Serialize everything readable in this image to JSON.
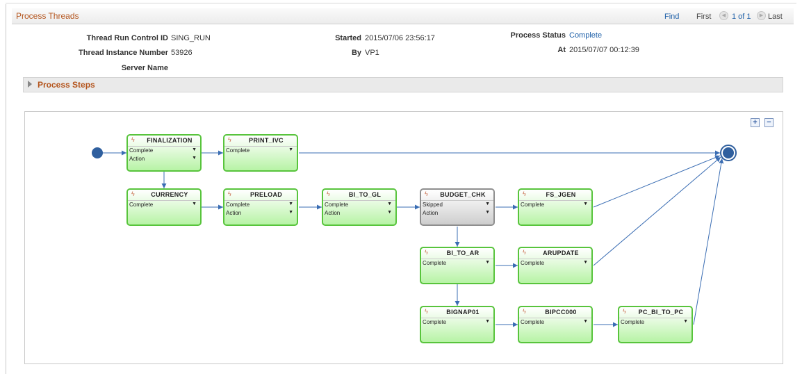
{
  "header": {
    "title": "Process Threads",
    "find": "Find",
    "first": "First",
    "count": "1 of 1",
    "last": "Last"
  },
  "fields": {
    "run_control_label": "Thread Run Control ID",
    "run_control_value": "SING_RUN",
    "instance_label": "Thread Instance Number",
    "instance_value": "53926",
    "server_label": "Server Name",
    "server_value": "",
    "started_label": "Started",
    "started_value": "2015/07/06 23:56:17",
    "by_label": "By",
    "by_value": "VP1",
    "status_label": "Process Status",
    "status_value": "Complete",
    "at_label": "At",
    "at_value": "2015/07/07 00:12:39"
  },
  "steps_section": {
    "title": "Process Steps"
  },
  "zoom": {
    "in": "+",
    "out": "−"
  },
  "icons": {
    "step": "lightning-icon",
    "expand": "triangle-right-icon",
    "dropdown": "caret-down-icon",
    "nav": "circle-arrow-icon"
  },
  "colors": {
    "title": "#b4541c",
    "link": "#1d5fa8",
    "node_border": "#58c43c",
    "node_skipped_border": "#8e8e8e",
    "connector": "#3a6db3"
  },
  "nodes": [
    {
      "id": "FINALIZATION",
      "status": "Complete",
      "action": "Action",
      "skipped": false
    },
    {
      "id": "PRINT_IVC",
      "status": "Complete",
      "action": "",
      "skipped": false
    },
    {
      "id": "CURRENCY",
      "status": "Complete",
      "action": "",
      "skipped": false
    },
    {
      "id": "PRELOAD",
      "status": "Complete",
      "action": "Action",
      "skipped": false
    },
    {
      "id": "BI_TO_GL",
      "status": "Complete",
      "action": "Action",
      "skipped": false
    },
    {
      "id": "BUDGET_CHK",
      "status": "Skipped",
      "action": "Action",
      "skipped": true
    },
    {
      "id": "FS_JGEN",
      "status": "Complete",
      "action": "",
      "skipped": false
    },
    {
      "id": "BI_TO_AR",
      "status": "Complete",
      "action": "",
      "skipped": false
    },
    {
      "id": "ARUPDATE",
      "status": "Complete",
      "action": "",
      "skipped": false
    },
    {
      "id": "BIGNAP01",
      "status": "Complete",
      "action": "",
      "skipped": false
    },
    {
      "id": "BIPCC000",
      "status": "Complete",
      "action": "",
      "skipped": false
    },
    {
      "id": "PC_BI_TO_PC",
      "status": "Complete",
      "action": "",
      "skipped": false
    }
  ]
}
